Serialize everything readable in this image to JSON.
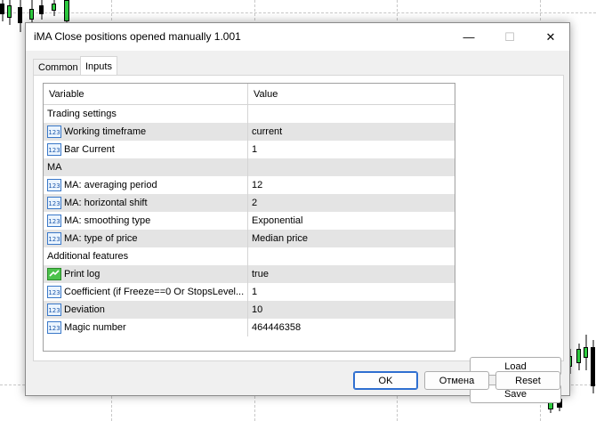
{
  "window": {
    "title": "iMA Close positions opened manually 1.001",
    "minimize_glyph": "—",
    "maximize_glyph": "☐",
    "close_glyph": "✕"
  },
  "tabs": [
    {
      "label": "Common",
      "active": false
    },
    {
      "label": "Inputs",
      "active": true
    }
  ],
  "grid": {
    "columns": [
      "Variable",
      "Value"
    ],
    "rows": [
      {
        "type": "section",
        "variable": "Trading settings",
        "value": ""
      },
      {
        "type": "param",
        "icon": "123-icon",
        "variable": "Working timeframe",
        "value": "current"
      },
      {
        "type": "param",
        "icon": "123-icon",
        "variable": "Bar Current",
        "value": "1"
      },
      {
        "type": "section",
        "variable": "MA",
        "value": ""
      },
      {
        "type": "param",
        "icon": "123-icon",
        "variable": "MA: averaging period",
        "value": "12"
      },
      {
        "type": "param",
        "icon": "123-icon",
        "variable": "MA: horizontal shift",
        "value": "2"
      },
      {
        "type": "param",
        "icon": "123-icon",
        "variable": "MA: smoothing type",
        "value": "Exponential"
      },
      {
        "type": "param",
        "icon": "123-icon",
        "variable": "MA: type of price",
        "value": "Median price"
      },
      {
        "type": "section",
        "variable": "Additional features",
        "value": ""
      },
      {
        "type": "param",
        "icon": "bool-icon",
        "variable": "Print log",
        "value": "true"
      },
      {
        "type": "param",
        "icon": "123-icon",
        "variable": "Coefficient (if Freeze==0 Or StopsLevel...",
        "value": "1"
      },
      {
        "type": "param",
        "icon": "123-icon",
        "variable": "Deviation",
        "value": "10"
      },
      {
        "type": "param",
        "icon": "123-icon",
        "variable": "Magic number",
        "value": "464446358"
      }
    ]
  },
  "side_buttons": {
    "load": "Load",
    "save": "Save"
  },
  "footer_buttons": {
    "ok": "OK",
    "cancel": "Отмена",
    "reset": "Reset"
  },
  "colors": {
    "accent": "#2f6fd0",
    "row_alt": "#e4e4e4",
    "bull_candle": "#2ecc40"
  }
}
